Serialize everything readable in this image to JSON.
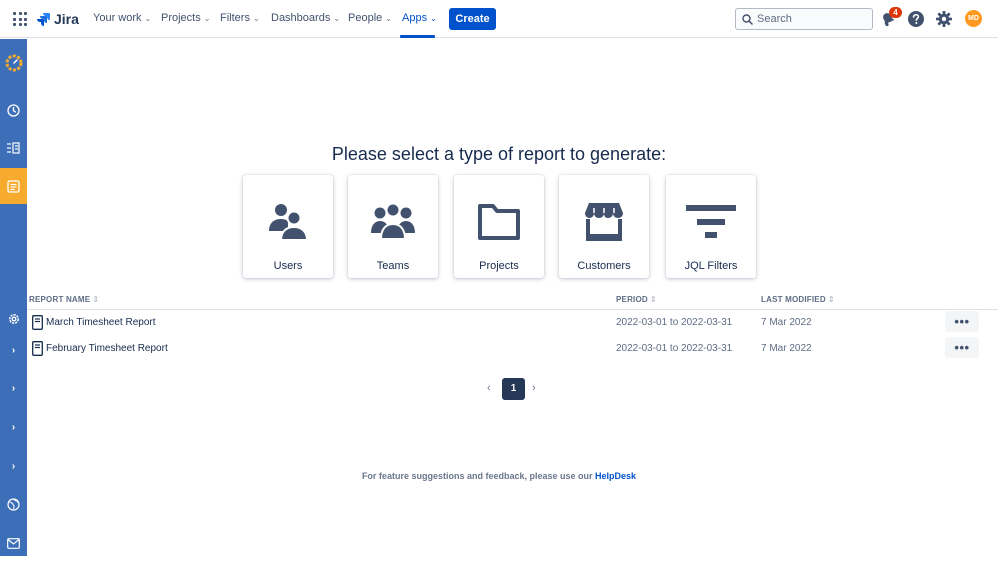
{
  "topnav": {
    "product": "Jira",
    "items": [
      {
        "label": "Your work",
        "active": false
      },
      {
        "label": "Projects",
        "active": false
      },
      {
        "label": "Filters",
        "active": false
      },
      {
        "label": "Dashboards",
        "active": false
      },
      {
        "label": "People",
        "active": false
      },
      {
        "label": "Apps",
        "active": true
      }
    ],
    "create_label": "Create",
    "search_placeholder": "Search",
    "notifications_count": "4",
    "avatar_initials": "MD"
  },
  "main": {
    "heading": "Please select a type of report to generate:",
    "report_types": [
      {
        "label": "Users",
        "icon": "users-icon"
      },
      {
        "label": "Teams",
        "icon": "teams-icon"
      },
      {
        "label": "Projects",
        "icon": "folder-icon"
      },
      {
        "label": "Customers",
        "icon": "store-icon"
      },
      {
        "label": "JQL Filters",
        "icon": "filter-icon"
      }
    ],
    "table": {
      "columns": [
        "REPORT NAME",
        "PERIOD",
        "LAST MODIFIED"
      ],
      "rows": [
        {
          "name": "March Timesheet Report",
          "period": "2022-03-01 to 2022-03-31",
          "modified": "7 Mar 2022",
          "more": "•••"
        },
        {
          "name": "February Timesheet Report",
          "period": "2022-03-01 to 2022-03-31",
          "modified": "7 Mar 2022",
          "more": "•••"
        }
      ]
    },
    "pagination": {
      "current_page": "1"
    },
    "footer": {
      "text": "For feature suggestions and feedback, please use our ",
      "link": "HelpDesk"
    }
  },
  "colors": {
    "brand_blue": "#0052cc",
    "sidebar_blue": "#3d6fb8",
    "sidebar_active": "#f6ab2f",
    "icon_dark": "#42526e"
  }
}
